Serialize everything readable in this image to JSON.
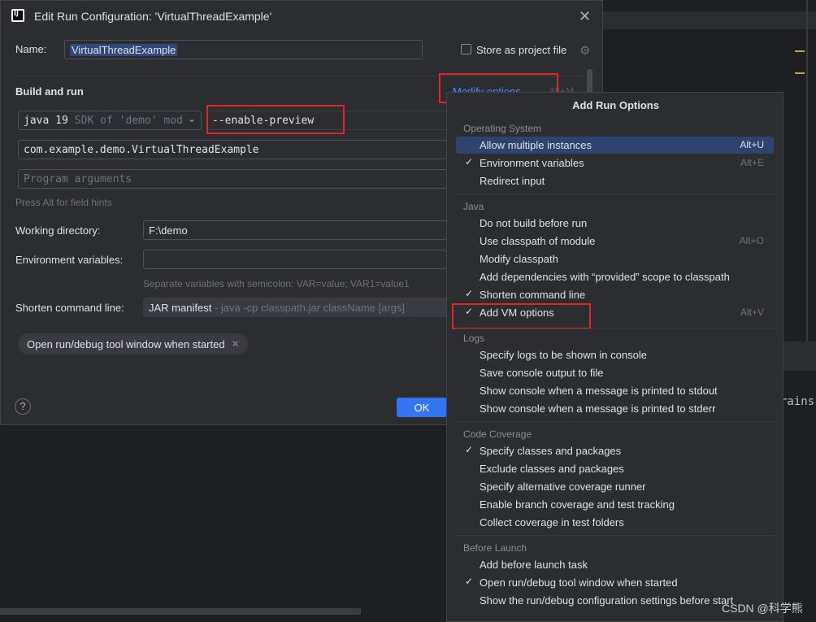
{
  "dialog": {
    "title": "Edit Run Configuration: 'VirtualThreadExample'",
    "name_label": "Name:",
    "name_value": "VirtualThreadExample",
    "store_label": "Store as project file",
    "build_run_label": "Build and run",
    "modify_options": "Modify options",
    "modify_shortcut": "Alt+M",
    "jdk": "java 19",
    "jdk_detail": "SDK of 'demo' module",
    "vm_options": "--enable-preview",
    "main_class": "com.example.demo.VirtualThreadExample",
    "program_args_placeholder": "Program arguments",
    "field_hint": "Press Alt for field hints",
    "working_dir_label": "Working directory:",
    "working_dir_value": "F:\\demo",
    "env_label": "Environment variables:",
    "env_hint": "Separate variables with semicolon: VAR=value; VAR1=value1",
    "shorten_label": "Shorten command line:",
    "shorten_value": "JAR manifest",
    "shorten_detail": " - java -cp classpath.jar className [args]",
    "tag_label": "Open run/debug tool window when started",
    "help": "?",
    "ok": "OK"
  },
  "popup": {
    "title": "Add Run Options",
    "groups": {
      "os": "Operating System",
      "java": "Java",
      "logs": "Logs",
      "coverage": "Code Coverage",
      "before": "Before Launch"
    },
    "items": [
      {
        "label": "Allow multiple instances",
        "shortcut": "Alt+U",
        "checked": false,
        "selected": true
      },
      {
        "label": "Environment variables",
        "shortcut": "Alt+E",
        "checked": true
      },
      {
        "label": "Redirect input",
        "shortcut": "",
        "checked": false
      },
      {
        "label": "Do not build before run",
        "shortcut": "",
        "checked": false
      },
      {
        "label": "Use classpath of module",
        "shortcut": "Alt+O",
        "checked": false
      },
      {
        "label": "Modify classpath",
        "shortcut": "",
        "checked": false
      },
      {
        "label": "Add dependencies with “provided” scope to classpath",
        "shortcut": "",
        "checked": false
      },
      {
        "label": "Shorten command line",
        "shortcut": "",
        "checked": true
      },
      {
        "label": "Add VM options",
        "shortcut": "Alt+V",
        "checked": true
      },
      {
        "label": "Specify logs to be shown in console",
        "shortcut": "",
        "checked": false
      },
      {
        "label": "Save console output to file",
        "shortcut": "",
        "checked": false
      },
      {
        "label": "Show console when a message is printed to stdout",
        "shortcut": "",
        "checked": false
      },
      {
        "label": "Show console when a message is printed to stderr",
        "shortcut": "",
        "checked": false
      },
      {
        "label": "Specify classes and packages",
        "shortcut": "",
        "checked": true
      },
      {
        "label": "Exclude classes and packages",
        "shortcut": "",
        "checked": false
      },
      {
        "label": "Specify alternative coverage runner",
        "shortcut": "",
        "checked": false
      },
      {
        "label": "Enable branch coverage and test tracking",
        "shortcut": "",
        "checked": false
      },
      {
        "label": "Collect coverage in test folders",
        "shortcut": "",
        "checked": false
      },
      {
        "label": "Add before launch task",
        "shortcut": "",
        "checked": false
      },
      {
        "label": "Open run/debug tool window when started",
        "shortcut": "",
        "checked": true
      },
      {
        "label": "Show the run/debug configuration settings before start",
        "shortcut": "",
        "checked": false
      }
    ],
    "check_glyph": "✓"
  },
  "ide": {
    "text_fragment": "rains"
  },
  "watermark": "CSDN @科学熊",
  "colors": {
    "accent": "#3574f0",
    "link": "#548af7",
    "highlight": "#e0242a",
    "selection": "#2e436e"
  }
}
